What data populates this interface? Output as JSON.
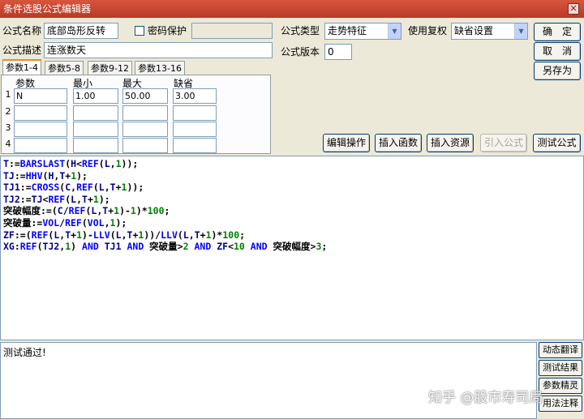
{
  "window": {
    "title": "条件选股公式编辑器",
    "close_glyph": "✕"
  },
  "form": {
    "name_label": "公式名称",
    "name_value": "底部岛形反转",
    "password_label": "密码保护",
    "password_value": "",
    "desc_label": "公式描述",
    "desc_value": "连涨数天",
    "type_label": "公式类型",
    "type_value": "走势特征",
    "version_label": "公式版本",
    "version_value": "0",
    "adjust_label": "使用复权",
    "adjust_value": "缺省设置"
  },
  "buttons": {
    "confirm": "确　定",
    "cancel": "取　消",
    "save_as": "另存为",
    "edit_ops": "编辑操作",
    "insert_func": "插入函数",
    "insert_res": "插入资源",
    "import_formula": "引入公式",
    "test_formula": "测试公式"
  },
  "tabs": [
    "参数1-4",
    "参数5-8",
    "参数9-12",
    "参数13-16"
  ],
  "param_headers": [
    "参数",
    "最小",
    "最大",
    "缺省"
  ],
  "param_rows": [
    {
      "num": "1",
      "name": "N",
      "min": "1.00",
      "max": "50.00",
      "default": "3.00"
    },
    {
      "num": "2",
      "name": "",
      "min": "",
      "max": "",
      "default": ""
    },
    {
      "num": "3",
      "name": "",
      "min": "",
      "max": "",
      "default": ""
    },
    {
      "num": "4",
      "name": "",
      "min": "",
      "max": "",
      "default": ""
    }
  ],
  "code_lines": [
    "T:=BARSLAST(H<REF(L,1));",
    "TJ:=HHV(H,T+1);",
    "TJ1:=CROSS(C,REF(L,T+1));",
    "TJ2:=TJ<REF(L,T+1);",
    "突破幅度:=(C/REF(L,T+1)-1)*100;",
    "突破量:=VOL/REF(VOL,1);",
    "ZF:=(REF(L,T+1)-LLV(L,T+1))/LLV(L,T+1)*100;",
    "XG:REF(TJ2,1) AND TJ1 AND 突破量>2 AND ZF<10 AND 突破幅度>3;"
  ],
  "output_text": "测试通过!",
  "side_buttons": [
    "动态翻译",
    "测试结果",
    "参数精灵",
    "用法注释"
  ],
  "watermark": "知乎 @股市寿司局"
}
